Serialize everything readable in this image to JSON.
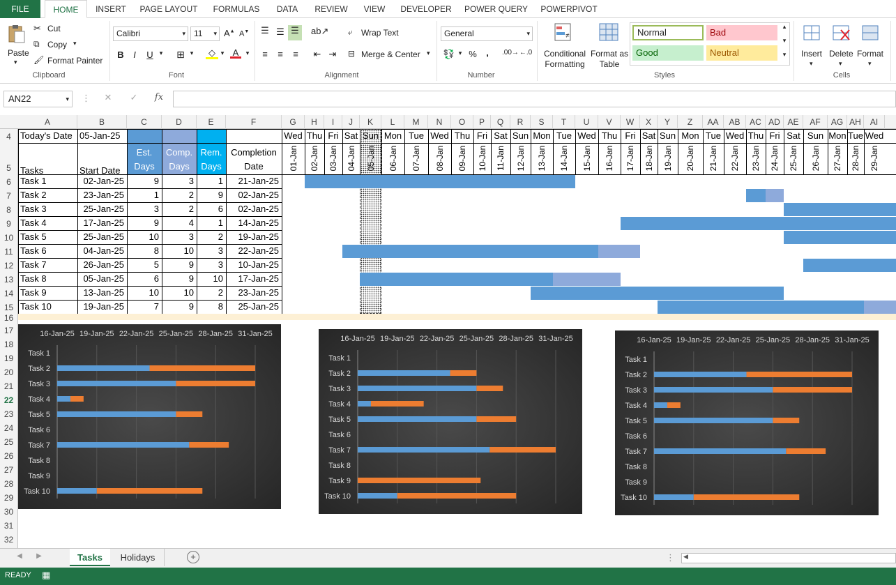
{
  "menu": {
    "file": "FILE",
    "tabs": [
      "HOME",
      "INSERT",
      "PAGE LAYOUT",
      "FORMULAS",
      "DATA",
      "REVIEW",
      "VIEW",
      "DEVELOPER",
      "POWER QUERY",
      "POWERPIVOT"
    ],
    "active": "HOME"
  },
  "ribbon": {
    "clipboard": {
      "paste": "Paste",
      "cut": "Cut",
      "copy": "Copy",
      "format_painter": "Format Painter",
      "label": "Clipboard"
    },
    "font": {
      "name": "Calibri",
      "size": "11",
      "label": "Font",
      "bold": "B",
      "italic": "I",
      "underline": "U"
    },
    "alignment": {
      "wrap": "Wrap Text",
      "merge": "Merge & Center",
      "label": "Alignment"
    },
    "number": {
      "format": "General",
      "label": "Number",
      "percent": "%",
      "comma": ","
    },
    "styles": {
      "conditional_formatting": "Conditional Formatting",
      "format_as_table": "Format as Table",
      "normal": "Normal",
      "bad": "Bad",
      "good": "Good",
      "neutral": "Neutral",
      "label": "Styles"
    },
    "cells": {
      "insert": "Insert",
      "delete": "Delete",
      "format": "Format",
      "label": "Cells"
    }
  },
  "formula_bar": {
    "name_box": "AN22",
    "fx": "fx",
    "formula": ""
  },
  "columns": [
    "A",
    "B",
    "C",
    "D",
    "E",
    "F",
    "G",
    "H",
    "I",
    "J",
    "K",
    "L",
    "M",
    "N",
    "O",
    "P",
    "Q",
    "R",
    "S",
    "T",
    "U",
    "V",
    "W",
    "X",
    "Y",
    "Z",
    "AA",
    "AB",
    "AC",
    "AD",
    "AE",
    "AF",
    "AG",
    "AH",
    "AI"
  ],
  "rows": [
    "4",
    "5",
    "6",
    "7",
    "8",
    "9",
    "10",
    "11",
    "12",
    "13",
    "14",
    "15",
    "16",
    "17",
    "18",
    "19",
    "20",
    "21",
    "22",
    "23",
    "24",
    "25",
    "26",
    "27",
    "28",
    "29",
    "30",
    "31",
    "32"
  ],
  "sheet": {
    "todays_date_label": "Today's Date",
    "todays_date": "05-Jan-25",
    "headers": {
      "tasks": "Tasks",
      "start": "Start Date",
      "est": "Est. Days",
      "comp": "Comp. Days",
      "rem": "Rem. Days",
      "completion": "Completion Date"
    },
    "header_colors": {
      "est": "#5b9bd5",
      "comp": "#8eaadb",
      "rem": "#00b0f0"
    },
    "tasks": [
      {
        "name": "Task 1",
        "start": "02-Jan-25",
        "est": 9,
        "comp": 3,
        "rem": 1,
        "completion": "21-Jan-25"
      },
      {
        "name": "Task 2",
        "start": "23-Jan-25",
        "est": 1,
        "comp": 2,
        "rem": 9,
        "completion": "02-Jan-25"
      },
      {
        "name": "Task 3",
        "start": "25-Jan-25",
        "est": 3,
        "comp": 2,
        "rem": 6,
        "completion": "02-Jan-25"
      },
      {
        "name": "Task 4",
        "start": "17-Jan-25",
        "est": 9,
        "comp": 4,
        "rem": 1,
        "completion": "14-Jan-25"
      },
      {
        "name": "Task 5",
        "start": "25-Jan-25",
        "est": 10,
        "comp": 3,
        "rem": 2,
        "completion": "19-Jan-25"
      },
      {
        "name": "Task 6",
        "start": "04-Jan-25",
        "est": 8,
        "comp": 10,
        "rem": 3,
        "completion": "22-Jan-25"
      },
      {
        "name": "Task 7",
        "start": "26-Jan-25",
        "est": 5,
        "comp": 9,
        "rem": 3,
        "completion": "10-Jan-25"
      },
      {
        "name": "Task 8",
        "start": "05-Jan-25",
        "est": 6,
        "comp": 9,
        "rem": 10,
        "completion": "17-Jan-25"
      },
      {
        "name": "Task 9",
        "start": "13-Jan-25",
        "est": 10,
        "comp": 10,
        "rem": 2,
        "completion": "23-Jan-25"
      },
      {
        "name": "Task 10",
        "start": "19-Jan-25",
        "est": 7,
        "comp": 9,
        "rem": 8,
        "completion": "25-Jan-25"
      }
    ],
    "days": [
      "Wed",
      "Thu",
      "Fri",
      "Sat",
      "Sun",
      "Mon",
      "Tue",
      "Wed",
      "Thu",
      "Fri",
      "Sat",
      "Sun",
      "Mon",
      "Tue",
      "Wed",
      "Thu",
      "Fri",
      "Sat",
      "Sun",
      "Mon",
      "Tue",
      "Wed",
      "Thu",
      "Fri",
      "Sat",
      "Sun",
      "Mon",
      "Tue",
      "Wed"
    ],
    "dates": [
      "01-Jan",
      "02-Jan",
      "03-Jan",
      "04-Jan",
      "05-Jan",
      "06-Jan",
      "07-Jan",
      "08-Jan",
      "09-Jan",
      "10-Jan",
      "11-Jan",
      "12-Jan",
      "13-Jan",
      "14-Jan",
      "15-Jan",
      "16-Jan",
      "17-Jan",
      "18-Jan",
      "19-Jan",
      "20-Jan",
      "21-Jan",
      "22-Jan",
      "23-Jan",
      "24-Jan",
      "25-Jan",
      "26-Jan",
      "27-Jan",
      "28-Jan",
      "29-Jan"
    ],
    "gantt": [
      {
        "task": "Task 1",
        "segments": [
          {
            "from": "02-Jan",
            "to": "14-Jan",
            "kind": "completed"
          }
        ]
      },
      {
        "task": "Task 2",
        "segments": [
          {
            "from": "23-Jan",
            "to": "23-Jan",
            "kind": "completed"
          },
          {
            "from": "24-Jan",
            "to": "24-Jan",
            "kind": "remaining"
          }
        ]
      },
      {
        "task": "Task 3",
        "segments": [
          {
            "from": "25-Jan",
            "to": "29-Jan",
            "kind": "completed"
          }
        ]
      },
      {
        "task": "Task 4",
        "segments": [
          {
            "from": "17-Jan",
            "to": "29-Jan",
            "kind": "completed"
          }
        ]
      },
      {
        "task": "Task 5",
        "segments": [
          {
            "from": "25-Jan",
            "to": "29-Jan",
            "kind": "completed"
          }
        ]
      },
      {
        "task": "Task 6",
        "segments": [
          {
            "from": "04-Jan",
            "to": "15-Jan",
            "kind": "completed"
          },
          {
            "from": "16-Jan",
            "to": "17-Jan",
            "kind": "remaining"
          }
        ]
      },
      {
        "task": "Task 7",
        "segments": [
          {
            "from": "26-Jan",
            "to": "29-Jan",
            "kind": "completed"
          }
        ]
      },
      {
        "task": "Task 8",
        "segments": [
          {
            "from": "05-Jan",
            "to": "13-Jan",
            "kind": "completed"
          },
          {
            "from": "14-Jan",
            "to": "16-Jan",
            "kind": "remaining"
          }
        ]
      },
      {
        "task": "Task 9",
        "segments": [
          {
            "from": "13-Jan",
            "to": "24-Jan",
            "kind": "completed"
          }
        ]
      },
      {
        "task": "Task 10",
        "segments": [
          {
            "from": "19-Jan",
            "to": "28-Jan",
            "kind": "completed"
          },
          {
            "from": "29-Jan",
            "to": "29-Jan",
            "kind": "remaining"
          }
        ]
      }
    ],
    "today_column": "05-Jan"
  },
  "chart_data": [
    {
      "type": "bar",
      "orientation": "horizontal",
      "stacked": true,
      "categories": [
        "Task 1",
        "Task 2",
        "Task 3",
        "Task 4",
        "Task 5",
        "Task 6",
        "Task 7",
        "Task 8",
        "Task 9",
        "Task 10"
      ],
      "x_ticks": [
        "16-Jan-25",
        "19-Jan-25",
        "22-Jan-25",
        "25-Jan-25",
        "28-Jan-25",
        "31-Jan-25"
      ],
      "series": [
        {
          "color": "#5b9bd5",
          "values": [
            null,
            23,
            25,
            17,
            25,
            null,
            26,
            null,
            null,
            19
          ]
        },
        {
          "color": "#ed7d31",
          "values": [
            null,
            8,
            6,
            1,
            2,
            null,
            3,
            null,
            null,
            8
          ]
        }
      ]
    },
    {
      "type": "bar",
      "orientation": "horizontal",
      "stacked": true,
      "categories": [
        "Task 1",
        "Task 2",
        "Task 3",
        "Task 4",
        "Task 5",
        "Task 6",
        "Task 7",
        "Task 8",
        "Task 9",
        "Task 10"
      ],
      "x_ticks": [
        "16-Jan-25",
        "19-Jan-25",
        "22-Jan-25",
        "25-Jan-25",
        "28-Jan-25",
        "31-Jan-25"
      ],
      "series": [
        {
          "color": "#5b9bd5",
          "values": [
            null,
            23,
            25,
            17,
            25,
            null,
            26,
            null,
            null,
            19
          ]
        },
        {
          "color": "#ed7d31",
          "values": [
            null,
            2,
            2,
            4,
            3,
            null,
            5,
            null,
            7,
            9
          ]
        }
      ]
    },
    {
      "type": "bar",
      "orientation": "horizontal",
      "stacked": true,
      "categories": [
        "Task 1",
        "Task 2",
        "Task 3",
        "Task 4",
        "Task 5",
        "Task 6",
        "Task 7",
        "Task 8",
        "Task 9",
        "Task 10"
      ],
      "x_ticks": [
        "16-Jan-25",
        "19-Jan-25",
        "22-Jan-25",
        "25-Jan-25",
        "28-Jan-25",
        "31-Jan-25"
      ],
      "series": [
        {
          "color": "#5b9bd5",
          "values": [
            null,
            23,
            25,
            17,
            25,
            null,
            26,
            null,
            null,
            19
          ]
        },
        {
          "color": "#ed7d31",
          "values": [
            null,
            8,
            6,
            1,
            2,
            null,
            3,
            null,
            null,
            8
          ]
        }
      ]
    }
  ],
  "sheet_tabs": [
    "Tasks",
    "Holidays"
  ],
  "active_sheet": "Tasks",
  "status": "READY"
}
